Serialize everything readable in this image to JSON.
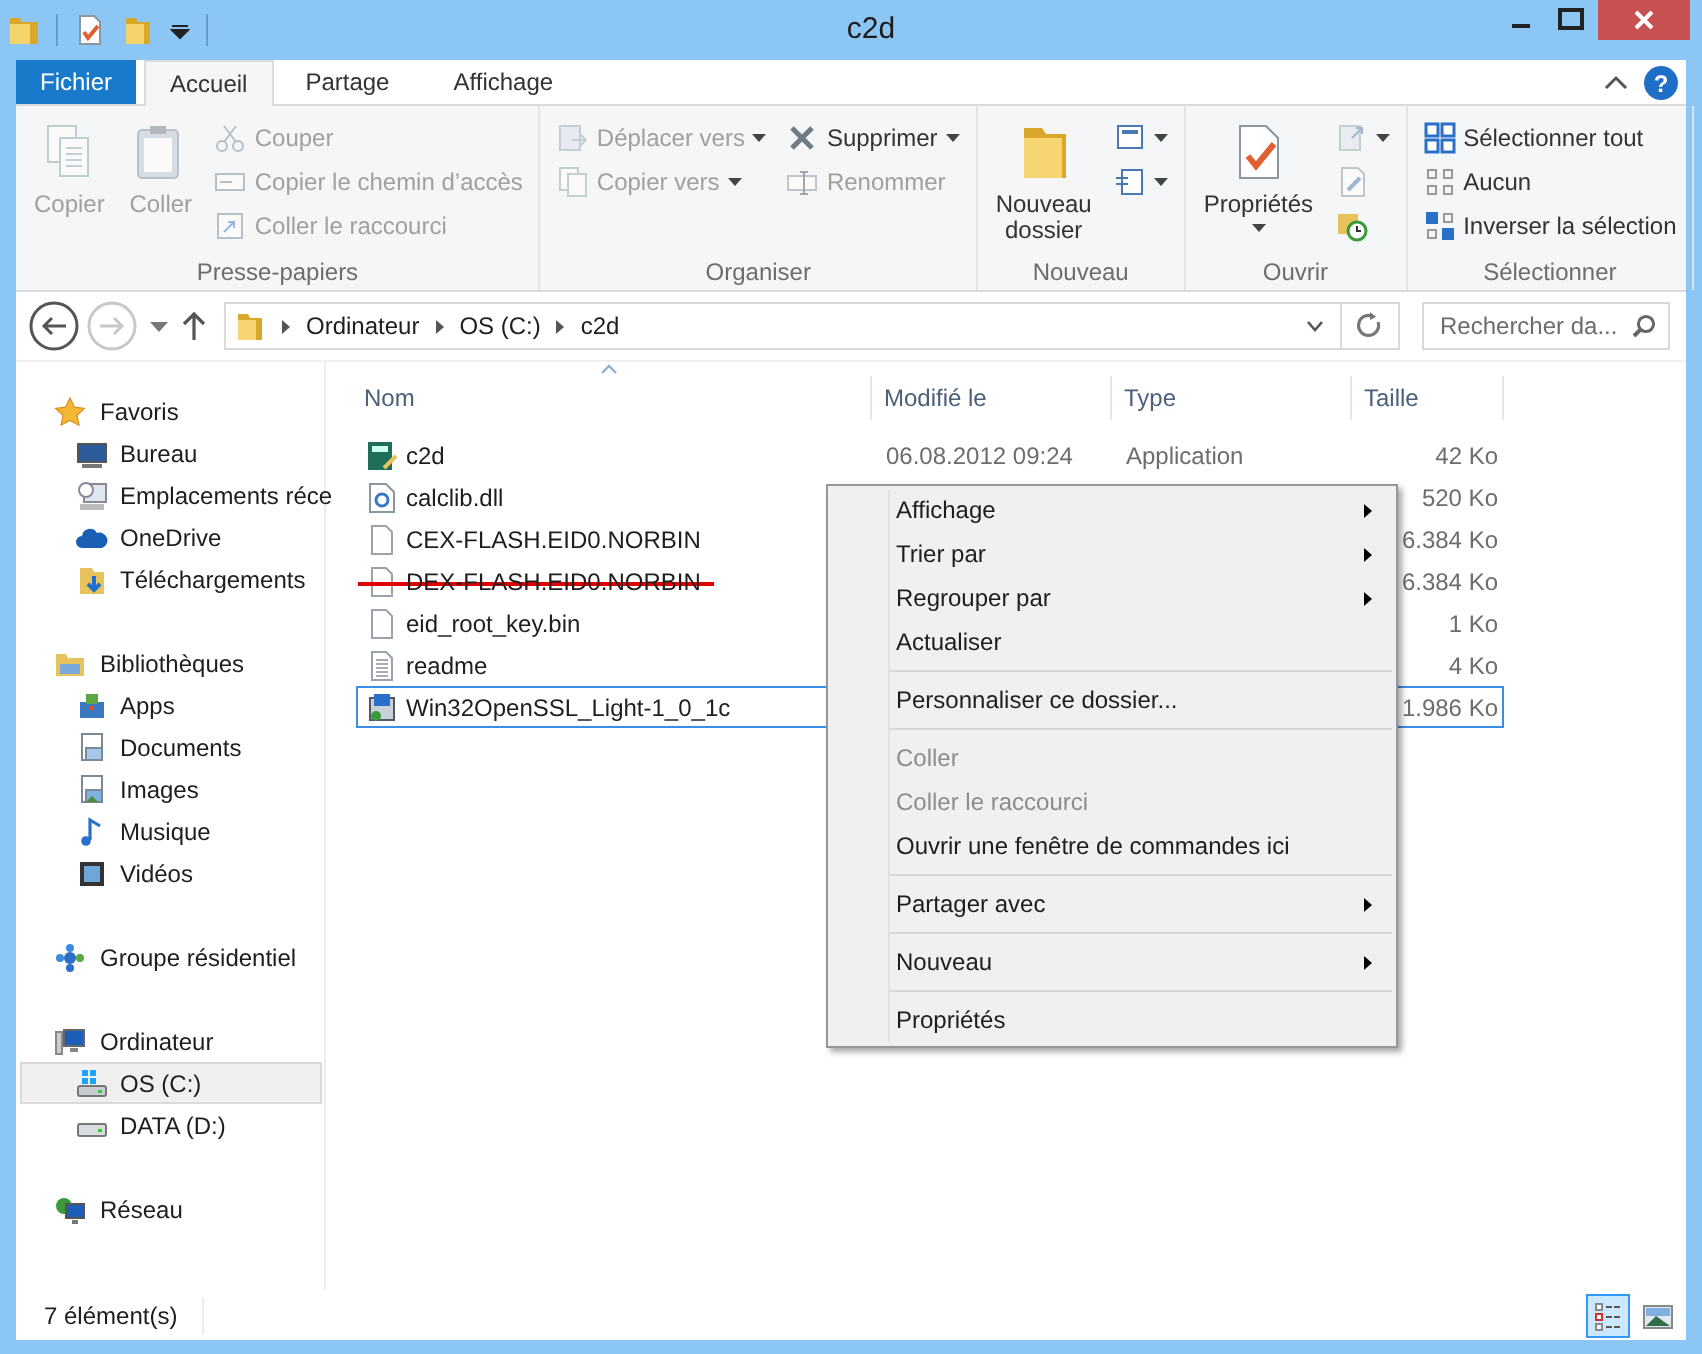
{
  "window": {
    "title": "c2d"
  },
  "ribbon": {
    "tabs": [
      {
        "label": "Fichier",
        "kind": "file",
        "selected": false
      },
      {
        "label": "Accueil",
        "kind": "tab",
        "selected": true
      },
      {
        "label": "Partage",
        "kind": "tab",
        "selected": false
      },
      {
        "label": "Affichage",
        "kind": "tab",
        "selected": false
      }
    ],
    "help": "?",
    "groups": [
      {
        "label": "Presse-papiers",
        "columns": [
          [
            {
              "kind": "large",
              "label": "Copier",
              "disabled": true,
              "dropdown": false
            }
          ],
          [
            {
              "kind": "large",
              "label": "Coller",
              "disabled": true,
              "dropdown": false
            }
          ],
          [
            {
              "kind": "small",
              "label": "Couper",
              "disabled": true,
              "dropdown": false
            },
            {
              "kind": "small",
              "label": "Copier le chemin d’accès",
              "disabled": true,
              "dropdown": false
            },
            {
              "kind": "small",
              "label": "Coller le raccourci",
              "disabled": true,
              "dropdown": false
            }
          ]
        ]
      },
      {
        "label": "Organiser",
        "columns": [
          [
            {
              "kind": "small",
              "label": "Déplacer vers",
              "disabled": true,
              "dropdown": true
            },
            {
              "kind": "small",
              "label": "Copier vers",
              "disabled": true,
              "dropdown": true
            }
          ],
          [
            {
              "kind": "small",
              "label": "Supprimer",
              "disabled": false,
              "dropdown": true
            },
            {
              "kind": "small",
              "label": "Renommer",
              "disabled": true,
              "dropdown": false
            }
          ]
        ]
      },
      {
        "label": "Nouveau",
        "columns": [
          [
            {
              "kind": "large",
              "label": "Nouveau dossier",
              "disabled": false,
              "dropdown": false
            }
          ],
          [
            {
              "kind": "small",
              "disabled": false,
              "dropdown": true
            },
            {
              "kind": "small",
              "disabled": false,
              "dropdown": true
            }
          ]
        ]
      },
      {
        "label": "Ouvrir",
        "columns": [
          [
            {
              "kind": "large",
              "label": "Propriétés",
              "disabled": false,
              "dropdown": true
            }
          ],
          [
            {
              "kind": "small",
              "disabled": true,
              "dropdown": true
            },
            {
              "kind": "small",
              "disabled": true,
              "dropdown": false
            },
            {
              "kind": "small",
              "disabled": false,
              "dropdown": false
            }
          ]
        ]
      },
      {
        "label": "Sélectionner",
        "columns": [
          [
            {
              "kind": "small",
              "label": "Sélectionner tout",
              "disabled": false,
              "dropdown": false
            },
            {
              "kind": "small",
              "label": "Aucun",
              "disabled": false,
              "dropdown": false
            },
            {
              "kind": "small",
              "label": "Inverser la sélection",
              "disabled": false,
              "dropdown": false
            }
          ]
        ]
      }
    ]
  },
  "address_bar": {
    "back": {
      "disabled": false
    },
    "forward": {
      "disabled": true
    },
    "path": [
      "Ordinateur",
      "OS (C:)",
      "c2d"
    ]
  },
  "search": {
    "placeholder": "Rechercher da..."
  },
  "navigation": [
    {
      "label": "Favoris",
      "selected": false,
      "children": [
        {
          "label": "Bureau",
          "selected": false
        },
        {
          "label": "Emplacements réce",
          "selected": false
        },
        {
          "label": "OneDrive",
          "selected": false
        },
        {
          "label": "Téléchargements",
          "selected": false
        }
      ]
    },
    {
      "label": "Bibliothèques",
      "selected": false,
      "children": [
        {
          "label": "Apps",
          "selected": false
        },
        {
          "label": "Documents",
          "selected": false
        },
        {
          "label": "Images",
          "selected": false
        },
        {
          "label": "Musique",
          "selected": false
        },
        {
          "label": "Vidéos",
          "selected": false
        }
      ]
    },
    {
      "label": "Groupe résidentiel",
      "selected": false
    },
    {
      "label": "Ordinateur",
      "selected": false,
      "children": [
        {
          "label": "OS (C:)",
          "selected": true
        },
        {
          "label": "DATA (D:)",
          "selected": false
        }
      ]
    },
    {
      "label": "Réseau",
      "selected": false
    }
  ],
  "file_list": {
    "columns": [
      {
        "label": "Nom",
        "sorted": true
      },
      {
        "label": "Modifié le",
        "sorted": false
      },
      {
        "label": "Type",
        "sorted": false
      },
      {
        "label": "Taille",
        "sorted": false
      }
    ],
    "rows": [
      {
        "name": "c2d",
        "modified": "06.08.2012 09:24",
        "type": "Application",
        "size": "42 Ko",
        "selected": false,
        "struck": false
      },
      {
        "name": "calclib.dll",
        "size": "520 Ko",
        "selected": false,
        "struck": false
      },
      {
        "name": "CEX-FLASH.EID0.NORBIN",
        "size": "6.384 Ko",
        "selected": false,
        "struck": false
      },
      {
        "name": "DEX-FLASH.EID0.NORBIN",
        "size": "6.384 Ko",
        "selected": false,
        "struck": true
      },
      {
        "name": "eid_root_key.bin",
        "size": "1 Ko",
        "selected": false,
        "struck": false
      },
      {
        "name": "readme",
        "size": "4 Ko",
        "selected": false,
        "struck": false
      },
      {
        "name": "Win32OpenSSL_Light-1_0_1c",
        "size": "1.986 Ko",
        "selected": true,
        "struck": false
      }
    ]
  },
  "context_menu": {
    "sections": [
      [
        {
          "label": "Affichage",
          "disabled": false,
          "submenu": true
        },
        {
          "label": "Trier par",
          "disabled": false,
          "submenu": true
        },
        {
          "label": "Regrouper par",
          "disabled": false,
          "submenu": true
        },
        {
          "label": "Actualiser",
          "disabled": false,
          "submenu": false
        }
      ],
      [
        {
          "label": "Personnaliser ce dossier...",
          "disabled": false,
          "submenu": false
        }
      ],
      [
        {
          "label": "Coller",
          "disabled": true,
          "submenu": false
        },
        {
          "label": "Coller le raccourci",
          "disabled": true,
          "submenu": false
        },
        {
          "label": "Ouvrir une fenêtre de commandes ici",
          "disabled": false,
          "submenu": false
        }
      ],
      [
        {
          "label": "Partager avec",
          "disabled": false,
          "submenu": true
        }
      ],
      [
        {
          "label": "Nouveau",
          "disabled": false,
          "submenu": true
        }
      ],
      [
        {
          "label": "Propriétés",
          "disabled": false,
          "submenu": false
        }
      ]
    ]
  },
  "status_bar": {
    "item_count": "7 élément(s)",
    "views": [
      {
        "kind": "details",
        "selected": true
      },
      {
        "kind": "large_icons",
        "selected": false
      }
    ]
  }
}
